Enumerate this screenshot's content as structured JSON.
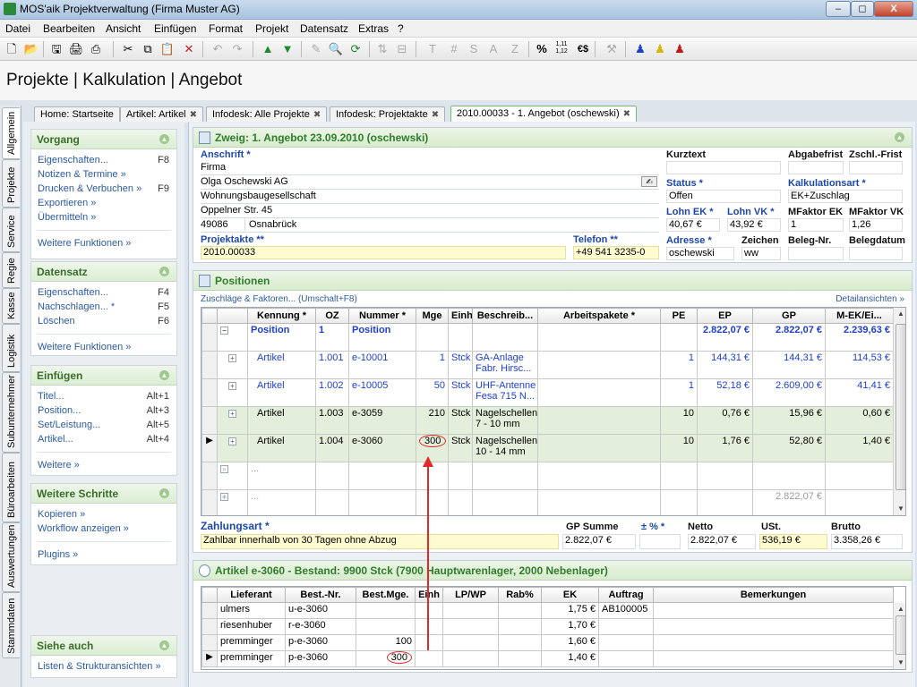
{
  "window": {
    "title": "MOS'aik Projektverwaltung (Firma Muster AG)",
    "controls": [
      "–",
      "◻",
      "X"
    ]
  },
  "menu": [
    "Datei",
    "Bearbeiten",
    "Ansicht",
    "Einfügen",
    "Format",
    "Projekt",
    "Datensatz",
    "Extras",
    "?"
  ],
  "toolbar": {
    "text_buttons": [
      "T",
      "#",
      "S",
      "A",
      "Z"
    ],
    "percent": "%",
    "decimals": "1,11\n1,12",
    "currency": "€$"
  },
  "breadcrumb": "Projekte | Kalkulation | Angebot",
  "tabs": [
    {
      "label": "Home: Startseite",
      "closable": false
    },
    {
      "label": "Artikel: Artikel",
      "closable": true
    },
    {
      "label": "Infodesk: Alle Projekte",
      "closable": true
    },
    {
      "label": "Infodesk: Projektakte",
      "closable": true
    },
    {
      "label": "2010.00033 - 1. Angebot (oschewski)",
      "closable": true,
      "active": true
    }
  ],
  "vertical_tabs": [
    "Allgemein",
    "Projekte",
    "Service",
    "Regie",
    "Kasse",
    "Logistik",
    "Subunternehmer",
    "Büroarbeiten",
    "Auswertungen",
    "Stammdaten"
  ],
  "left_panels": {
    "vorgang": {
      "title": "Vorgang",
      "items": [
        {
          "label": "Eigenschaften...",
          "key": "F8"
        },
        {
          "label": "Notizen & Termine »",
          "key": ""
        },
        {
          "label": "Drucken & Verbuchen »",
          "key": "F9"
        },
        {
          "label": "Exportieren »",
          "key": ""
        },
        {
          "label": "Übermitteln »",
          "key": ""
        }
      ],
      "more": "Weitere Funktionen »"
    },
    "datensatz": {
      "title": "Datensatz",
      "items": [
        {
          "label": "Eigenschaften...",
          "key": "F4"
        },
        {
          "label": "Nachschlagen... *",
          "key": "F5"
        },
        {
          "label": "Löschen",
          "key": "F6"
        }
      ],
      "more": "Weitere Funktionen »"
    },
    "einfuegen": {
      "title": "Einfügen",
      "items": [
        {
          "label": "Titel...",
          "key": "Alt+1"
        },
        {
          "label": "Position...",
          "key": "Alt+3"
        },
        {
          "label": "Set/Leistung...",
          "key": "Alt+5"
        },
        {
          "label": "Artikel...",
          "key": "Alt+4"
        }
      ],
      "more": "Weitere »"
    },
    "weitere_schritte": {
      "title": "Weitere Schritte",
      "items": [
        {
          "label": "Kopieren »",
          "key": ""
        },
        {
          "label": "Workflow anzeigen »",
          "key": ""
        }
      ],
      "more": "Plugins »"
    },
    "siehe_auch": {
      "title": "Siehe auch",
      "items": [
        {
          "label": "Listen & Strukturansichten »",
          "key": ""
        }
      ]
    }
  },
  "zweig": {
    "title": "Zweig: 1. Angebot 23.09.2010 (oschewski)",
    "anschrift_label": "Anschrift *",
    "anschrift": [
      "Firma",
      "Olga Oschewski AG",
      "Wohnungsbaugesellschaft",
      "Oppelner Str. 45"
    ],
    "plz": "49086",
    "ort": "Osnabrück",
    "projektakte_label": "Projektakte **",
    "projektakte": "2010.00033",
    "telefon_label": "Telefon **",
    "telefon": "+49 541 3235-0",
    "kurztext_label": "Kurztext",
    "kurztext": "",
    "abgabefrist_label": "Abgabefrist",
    "abgabefrist": "",
    "zahlfrist_label": "Zschl.-Frist",
    "zahlfrist": "",
    "status_label": "Status *",
    "status": "Offen",
    "kalkulationsart_label": "Kalkulationsart *",
    "kalkulationsart": "EK+Zuschlag",
    "lohn_ek_label": "Lohn EK *",
    "lohn_ek": "40,67 €",
    "lohn_vk_label": "Lohn VK *",
    "lohn_vk": "43,92 €",
    "mfaktor_ek_label": "MFaktor EK",
    "mfaktor_ek": "1",
    "mfaktor_vk_label": "MFaktor VK",
    "mfaktor_vk": "1,26",
    "adresse_label": "Adresse *",
    "adresse": "oschewski",
    "zeichen_label": "Zeichen",
    "zeichen": "ww",
    "beleg_nr_label": "Beleg-Nr.",
    "beleg_nr": "",
    "belegdatum_label": "Belegdatum",
    "belegdatum": ""
  },
  "positionen": {
    "title": "Positionen",
    "link_left": "Zuschläge & Faktoren... (Umschalt+F8)",
    "link_right": "Detailansichten »",
    "columns": [
      "Kennung *",
      "OZ",
      "Nummer *",
      "Mge",
      "Einh",
      "Beschreib...",
      "Arbeitspakete *",
      "PE",
      "EP",
      "GP",
      "M-EK/Ei..."
    ],
    "rows": [
      {
        "kennung": "Position",
        "oz": "1",
        "nummer": "Position",
        "mge": "",
        "einh": "",
        "beschr": "",
        "arb": "",
        "pe": "",
        "ep": "2.822,07 €",
        "gp": "2.822,07 €",
        "mek": "2.239,63 €",
        "style": "position"
      },
      {
        "kennung": "Artikel",
        "oz": "1.001",
        "nummer": "e-10001",
        "mge": "1",
        "einh": "Stck",
        "beschr": "GA-Anlage\nFabr. Hirsc...",
        "arb": "",
        "pe": "1",
        "ep": "144,31 €",
        "gp": "144,31 €",
        "mek": "114,53 €",
        "style": "blue"
      },
      {
        "kennung": "Artikel",
        "oz": "1.002",
        "nummer": "e-10005",
        "mge": "50",
        "einh": "Stck",
        "beschr": "UHF-Antenne\nFesa 715 N...",
        "arb": "",
        "pe": "1",
        "ep": "52,18 €",
        "gp": "2.609,00 €",
        "mek": "41,41 €",
        "style": "blue"
      },
      {
        "kennung": "Artikel",
        "oz": "1.003",
        "nummer": "e-3059",
        "mge": "210",
        "einh": "Stck",
        "beschr": "Nagelschellen\n7 - 10 mm",
        "arb": "",
        "pe": "10",
        "ep": "0,76 €",
        "gp": "15,96 €",
        "mek": "0,60 €",
        "style": "green"
      },
      {
        "kennung": "Artikel",
        "oz": "1.004",
        "nummer": "e-3060",
        "mge": "300",
        "einh": "Stck",
        "beschr": "Nagelschellen\n10 - 14 mm",
        "arb": "",
        "pe": "10",
        "ep": "1,76 €",
        "gp": "52,80 €",
        "mek": "1,40 €",
        "style": "selected"
      },
      {
        "kennung": "...",
        "oz": "",
        "nummer": "",
        "mge": "",
        "einh": "",
        "beschr": "",
        "arb": "",
        "pe": "",
        "ep": "",
        "gp": "",
        "mek": "",
        "style": "empty"
      },
      {
        "kennung": "...",
        "oz": "",
        "nummer": "",
        "mge": "",
        "einh": "",
        "beschr": "",
        "arb": "",
        "pe": "",
        "ep": "",
        "gp": "2.822,07 €",
        "mek": "",
        "style": "total"
      }
    ]
  },
  "summen": {
    "zahlungsart_label": "Zahlungsart *",
    "zahlungsart": "Zahlbar innerhalb von 30 Tagen ohne Abzug",
    "gp_summe_label": "GP Summe",
    "gp_summe": "2.822,07 €",
    "pct_label": "± % *",
    "pct": "",
    "netto_label": "Netto",
    "netto": "2.822,07 €",
    "ust_label": "USt.",
    "ust": "536,19 €",
    "brutto_label": "Brutto",
    "brutto": "3.358,26 €"
  },
  "artikel": {
    "title": "Artikel e-3060 - Bestand: 9900 Stck (7900 Hauptwarenlager, 2000 Nebenlager)",
    "columns": [
      "Lieferant",
      "Best.-Nr.",
      "Best.Mge.",
      "Einh",
      "LP/WP",
      "Rab%",
      "EK",
      "Auftrag",
      "Bemerkungen"
    ],
    "rows": [
      {
        "lieferant": "ulmers",
        "bestnr": "u-e-3060",
        "bestmge": "",
        "einh": "",
        "lp": "",
        "rab": "",
        "ek": "1,75 €",
        "auftrag": "AB100005",
        "bem": ""
      },
      {
        "lieferant": "riesenhuber",
        "bestnr": "r-e-3060",
        "bestmge": "",
        "einh": "",
        "lp": "",
        "rab": "",
        "ek": "1,70 €",
        "auftrag": "",
        "bem": ""
      },
      {
        "lieferant": "premminger",
        "bestnr": "p-e-3060",
        "bestmge": "100",
        "einh": "",
        "lp": "",
        "rab": "",
        "ek": "1,60 €",
        "auftrag": "",
        "bem": ""
      },
      {
        "lieferant": "premminger",
        "bestnr": "p-e-3060",
        "bestmge": "300",
        "einh": "",
        "lp": "",
        "rab": "",
        "ek": "1,40 €",
        "auftrag": "",
        "bem": ""
      }
    ]
  },
  "colors": {
    "accent_green": "#2f7d2b",
    "label_blue": "#1d48a7",
    "annotation_red": "#e02a2a",
    "highlight_yellow": "#fffbd0",
    "row_green": "#e3efda"
  }
}
